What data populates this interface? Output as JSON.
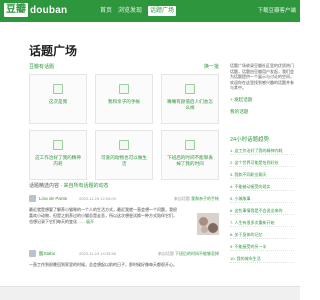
{
  "header": {
    "logo_badge": "豆瓣",
    "logo_text": "douban",
    "nav": [
      "首页",
      "浏览发现",
      "话题广场"
    ],
    "download": "下载豆瓣客户端"
  },
  "page_title": "话题广场",
  "section": {
    "heading": "豆瓣有话题",
    "more": "换一批"
  },
  "topics": [
    {
      "label": "这次是我"
    },
    {
      "label": "我和亲子的手帐"
    },
    {
      "label": "嘴嘴有颜值后人们会怎么样"
    },
    {
      "label": "这工作治好了我的精神内耗"
    },
    {
      "label": "可爱的动物也可以做生活"
    },
    {
      "label": "下班后的时间不能够丢掉了我的时间"
    }
  ],
  "aside": {
    "intro": "话题广场收录豆瓣社区里的优质热门话题，话题由豆瓣用户发起，我们会为话题提供一个展示与讨论的空间，欢迎你在这里找到感兴趣的话题并参与其中。",
    "create_link": "+ 发起话题",
    "my_link": "我的话题",
    "hot_title": "24小时话题趋势",
    "hot": [
      "1. 这工作治好了我的精神内耗",
      "2. 这个世界可能是恰到好处",
      "3. 我和不同职业聊天",
      "4. 不能被动接受的现实",
      "5. 小城故事",
      "6. 这些事情我是不会说出来的",
      "7. 人生有很多次重新开始",
      "8. 关于身体的记忆",
      "9. 不能接受的另一半",
      "10. 我的城市生活"
    ]
  },
  "highlights": {
    "prefix": "话题精选内容 · ",
    "link": "来自所有话题的动态"
  },
  "posts": [
    {
      "author": "Lina de Pants",
      "date": "2023-11-19 12:04:09",
      "cat_prefix": "来自话题",
      "cat": "我和亲子的手帐",
      "body": "最近就是想要了解养小猫咪的一个人的生活方式，最近我就一直会想一个问题，我很喜欢小动物，但是之前养过的小猫总是走丢，所以这次想尝试换一种方式陪伴它们，也想记录下它们每天的变化……",
      "more": "展开"
    },
    {
      "author": "酸Slabo",
      "date": "2023-11-19 14:33:56",
      "cat_prefix": "来自话题",
      "cat": "下班后的时间不能够丢掉",
      "body": "一直工作到很晚回到家里的时候，总会想起以前的日子，那时候好像每天都很开心。"
    }
  ],
  "colors": {
    "brand": "#2e963d",
    "accent": "#2e963d"
  }
}
